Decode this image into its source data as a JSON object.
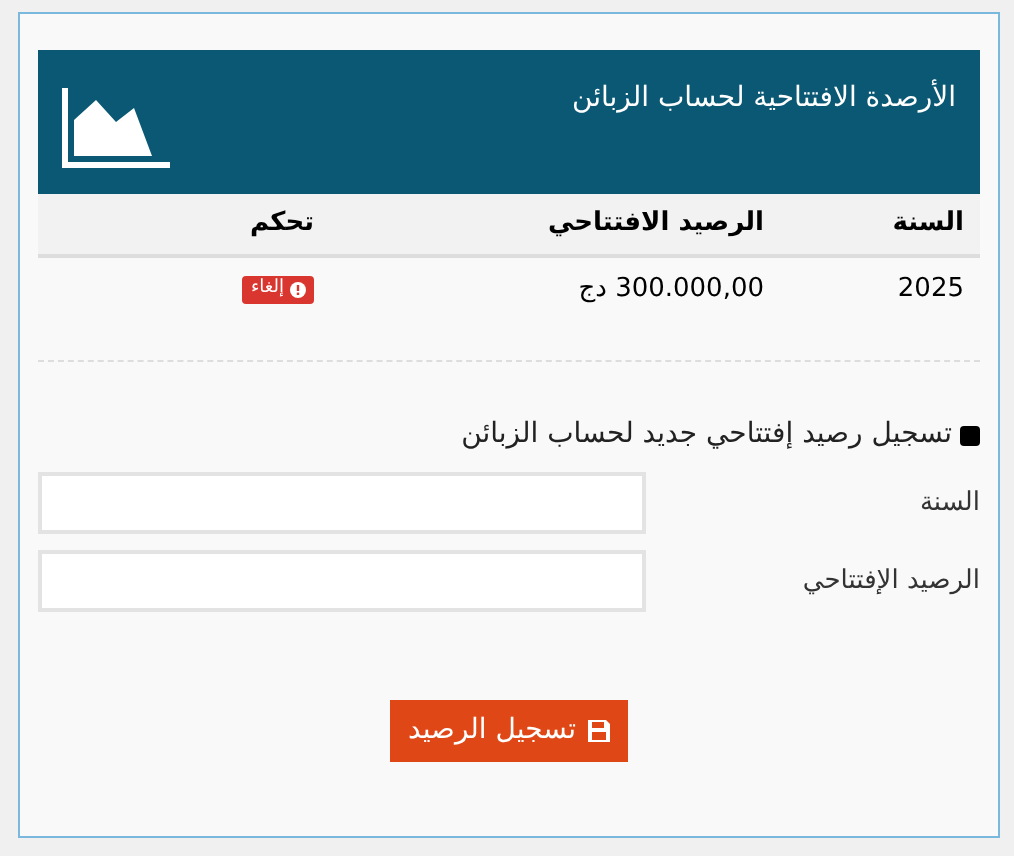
{
  "header": {
    "title": "الأرصدة الافتتاحية لحساب الزبائن"
  },
  "table": {
    "columns": [
      "السنة",
      "الرصيد الافتتاحي",
      "تحكم"
    ],
    "rows": [
      {
        "year": "2025",
        "balance": "300.000,00 دج",
        "action": "إلغاء"
      }
    ]
  },
  "form": {
    "title": "تسجيل رصيد إفتتاحي جديد لحساب الزبائن",
    "fields": [
      {
        "label": "السنة"
      },
      {
        "label": "الرصيد الإفتتاحي"
      }
    ],
    "submit": "تسجيل الرصيد"
  }
}
